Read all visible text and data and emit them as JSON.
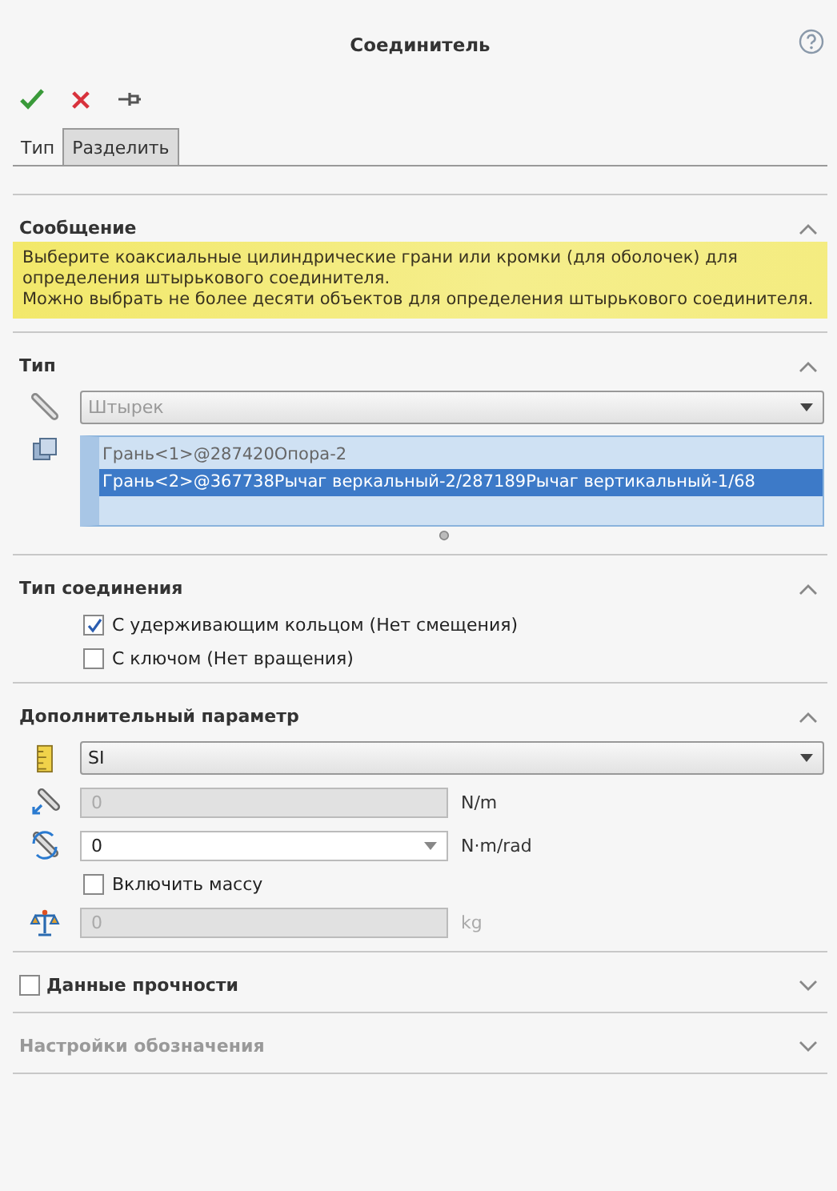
{
  "window": {
    "title": "Соединитель"
  },
  "actions": [
    {
      "kind": "ok"
    },
    {
      "kind": "cancel"
    },
    {
      "kind": "pin"
    }
  ],
  "tabs": [
    {
      "label": "Тип",
      "selected": true
    },
    {
      "label": "Разделить",
      "selected": false
    }
  ],
  "sections": [
    {
      "kind": "message",
      "title": "Сообщение",
      "expanded": true,
      "lines": [
        "Выберите коаксиальные цилиндрические грани или кромки (для оболочек) для определения штырькового соединителя.",
        "Можно выбрать не более десяти объектов для определения штырькового соединителя."
      ]
    },
    {
      "kind": "type",
      "title": "Тип",
      "expanded": true,
      "dropdown": "Штырек",
      "selections": [
        {
          "text": "Грань<1>@287420Опора-2",
          "selected": false
        },
        {
          "text": "Грань<2>@367738Рычаг веркальный-2/287189Рычаг вертикальный-1/68",
          "selected": true
        }
      ]
    },
    {
      "kind": "options",
      "title": "Тип соединения",
      "expanded": true,
      "options": [
        {
          "label": "С удерживающим кольцом (Нет смещения)",
          "checked": true
        },
        {
          "label": "С ключом (Нет вращения)",
          "checked": false
        }
      ]
    },
    {
      "kind": "params",
      "title": "Дополнительный параметр",
      "expanded": true,
      "rows": [
        {
          "kind": "units",
          "value": "SI"
        },
        {
          "kind": "axial-field",
          "value": "0",
          "unit": "N/m",
          "disabled": true
        },
        {
          "kind": "torsion-field",
          "value": "0",
          "unit": "N·m/rad",
          "disabled": false
        },
        {
          "kind": "checkbox",
          "label": "Включить массу",
          "checked": false
        },
        {
          "kind": "mass-field",
          "value": "0",
          "unit": "kg",
          "disabled": true
        }
      ]
    },
    {
      "kind": "check-header",
      "title": "Данные прочности",
      "expanded": false,
      "checked": false
    },
    {
      "kind": "plain",
      "title": "Настройки обозначения",
      "expanded": false,
      "disabled": true
    }
  ]
}
